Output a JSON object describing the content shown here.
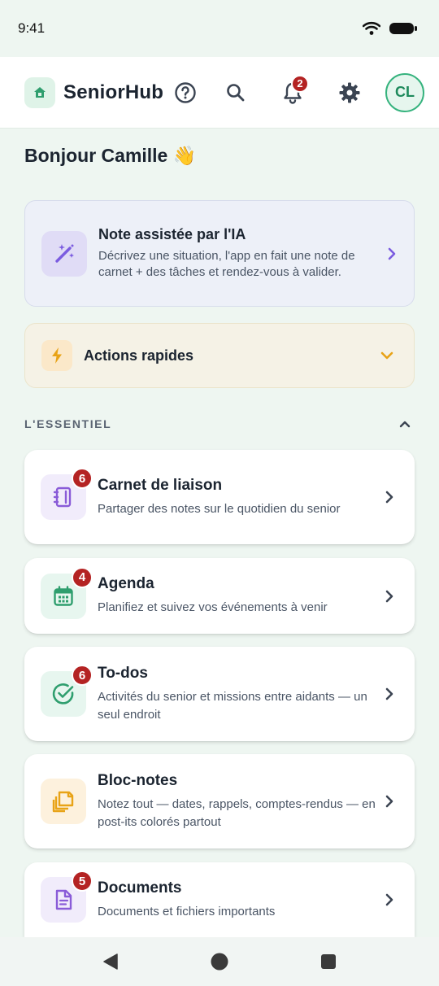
{
  "status_bar": {
    "time": "9:41"
  },
  "header": {
    "app_title": "SeniorHub",
    "notification_count": "2",
    "avatar_initials": "CL"
  },
  "greeting": "Bonjour Camille 👋",
  "ai_card": {
    "title": "Note assistée par l'IA",
    "description": "Décrivez une situation, l'app en fait une note de carnet + des tâches et rendez-vous à valider."
  },
  "quick_actions": {
    "label": "Actions rapides"
  },
  "section": {
    "title": "L'ESSENTIEL"
  },
  "modules": [
    {
      "title": "Carnet de liaison",
      "description": "Partager des notes sur le quotidien du senior",
      "badge": "6"
    },
    {
      "title": "Agenda",
      "description": "Planifiez et suivez vos événements à venir",
      "badge": "4"
    },
    {
      "title": "To-dos",
      "description": "Activités du senior et missions entre aidants — un seul endroit",
      "badge": "6"
    },
    {
      "title": "Bloc-notes",
      "description": "Notez tout — dates, rappels, comptes-rendus — en post-its colorés partout",
      "badge": ""
    },
    {
      "title": "Documents",
      "description": "Documents et fichiers importants",
      "badge": "5"
    }
  ],
  "colors": {
    "brand_green": "#36b37e",
    "badge_red": "#b42323",
    "ai_purple": "#7b5ce0",
    "quick_amber": "#e8a317"
  }
}
